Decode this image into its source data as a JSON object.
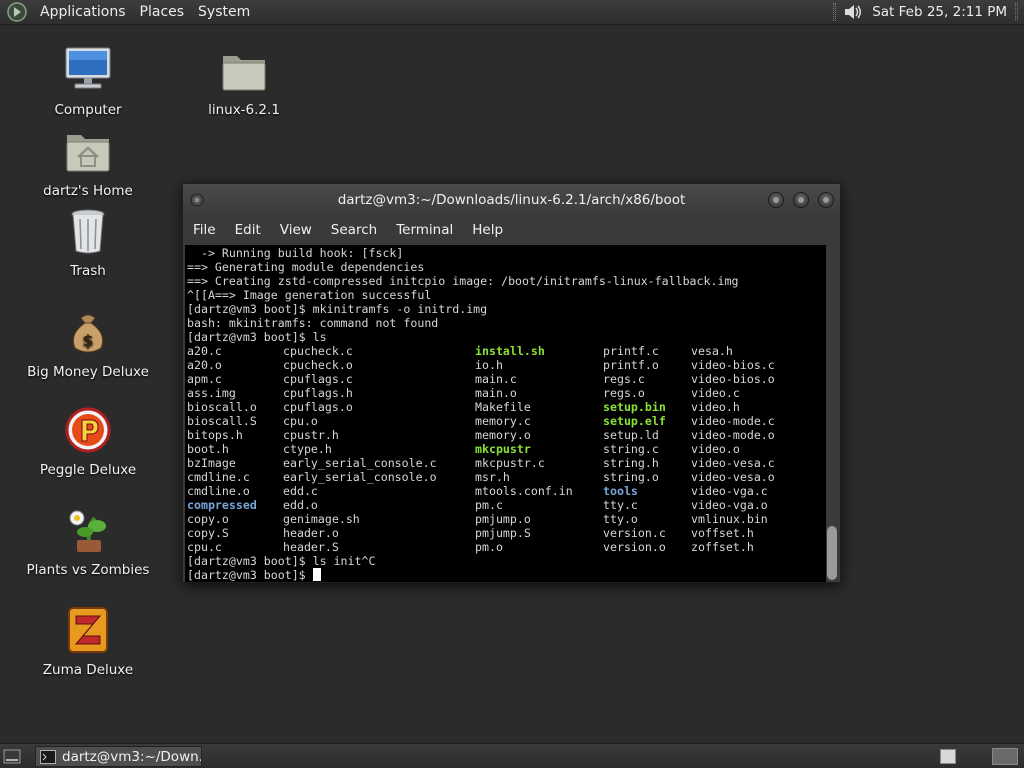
{
  "top_panel": {
    "menus": [
      "Applications",
      "Places",
      "System"
    ],
    "clock": "Sat Feb 25,  2:11 PM"
  },
  "desktop": {
    "icons": [
      {
        "label": "Computer",
        "icon": "computer-icon"
      },
      {
        "label": "linux-6.2.1",
        "icon": "folder-icon"
      },
      {
        "label": "dartz's Home",
        "icon": "home-folder-icon"
      },
      {
        "label": "Trash",
        "icon": "trash-icon"
      },
      {
        "label": "Big Money Deluxe",
        "icon": "money-bag-icon"
      },
      {
        "label": "Peggle Deluxe",
        "icon": "peggle-icon"
      },
      {
        "label": "Plants vs Zombies",
        "icon": "plants-vs-zombies-icon"
      },
      {
        "label": "Zuma Deluxe",
        "icon": "zuma-icon"
      }
    ]
  },
  "terminal": {
    "title": "dartz@vm3:~/Downloads/linux-6.2.1/arch/x86/boot",
    "menu": [
      "File",
      "Edit",
      "View",
      "Search",
      "Terminal",
      "Help"
    ],
    "lines_before": [
      "  -> Running build hook: [fsck]",
      "==> Generating module dependencies",
      "==> Creating zstd-compressed initcpio image: /boot/initramfs-linux-fallback.img",
      "^[[A==> Image generation successful",
      "[dartz@vm3 boot]$ mkinitramfs -o initrd.img",
      "bash: mkinitramfs: command not found",
      "[dartz@vm3 boot]$ ls"
    ],
    "ls_rows": [
      [
        {
          "t": "a20.c",
          "k": ""
        },
        {
          "t": "cpucheck.c",
          "k": ""
        },
        {
          "t": "install.sh",
          "k": "exe"
        },
        {
          "t": "printf.c",
          "k": ""
        },
        {
          "t": "vesa.h",
          "k": ""
        }
      ],
      [
        {
          "t": "a20.o",
          "k": ""
        },
        {
          "t": "cpucheck.o",
          "k": ""
        },
        {
          "t": "io.h",
          "k": ""
        },
        {
          "t": "printf.o",
          "k": ""
        },
        {
          "t": "video-bios.c",
          "k": ""
        }
      ],
      [
        {
          "t": "apm.c",
          "k": ""
        },
        {
          "t": "cpuflags.c",
          "k": ""
        },
        {
          "t": "main.c",
          "k": ""
        },
        {
          "t": "regs.c",
          "k": ""
        },
        {
          "t": "video-bios.o",
          "k": ""
        }
      ],
      [
        {
          "t": "ass.img",
          "k": ""
        },
        {
          "t": "cpuflags.h",
          "k": ""
        },
        {
          "t": "main.o",
          "k": ""
        },
        {
          "t": "regs.o",
          "k": ""
        },
        {
          "t": "video.c",
          "k": ""
        }
      ],
      [
        {
          "t": "bioscall.o",
          "k": ""
        },
        {
          "t": "cpuflags.o",
          "k": ""
        },
        {
          "t": "Makefile",
          "k": ""
        },
        {
          "t": "setup.bin",
          "k": "exe"
        },
        {
          "t": "video.h",
          "k": ""
        }
      ],
      [
        {
          "t": "bioscall.S",
          "k": ""
        },
        {
          "t": "cpu.o",
          "k": ""
        },
        {
          "t": "memory.c",
          "k": ""
        },
        {
          "t": "setup.elf",
          "k": "exe"
        },
        {
          "t": "video-mode.c",
          "k": ""
        }
      ],
      [
        {
          "t": "bitops.h",
          "k": ""
        },
        {
          "t": "cpustr.h",
          "k": ""
        },
        {
          "t": "memory.o",
          "k": ""
        },
        {
          "t": "setup.ld",
          "k": ""
        },
        {
          "t": "video-mode.o",
          "k": ""
        }
      ],
      [
        {
          "t": "boot.h",
          "k": ""
        },
        {
          "t": "ctype.h",
          "k": ""
        },
        {
          "t": "mkcpustr",
          "k": "exe"
        },
        {
          "t": "string.c",
          "k": ""
        },
        {
          "t": "video.o",
          "k": ""
        }
      ],
      [
        {
          "t": "bzImage",
          "k": ""
        },
        {
          "t": "early_serial_console.c",
          "k": ""
        },
        {
          "t": "mkcpustr.c",
          "k": ""
        },
        {
          "t": "string.h",
          "k": ""
        },
        {
          "t": "video-vesa.c",
          "k": ""
        }
      ],
      [
        {
          "t": "cmdline.c",
          "k": ""
        },
        {
          "t": "early_serial_console.o",
          "k": ""
        },
        {
          "t": "msr.h",
          "k": ""
        },
        {
          "t": "string.o",
          "k": ""
        },
        {
          "t": "video-vesa.o",
          "k": ""
        }
      ],
      [
        {
          "t": "cmdline.o",
          "k": ""
        },
        {
          "t": "edd.c",
          "k": ""
        },
        {
          "t": "mtools.conf.in",
          "k": ""
        },
        {
          "t": "tools",
          "k": "dir"
        },
        {
          "t": "video-vga.c",
          "k": ""
        }
      ],
      [
        {
          "t": "compressed",
          "k": "dir"
        },
        {
          "t": "edd.o",
          "k": ""
        },
        {
          "t": "pm.c",
          "k": ""
        },
        {
          "t": "tty.c",
          "k": ""
        },
        {
          "t": "video-vga.o",
          "k": ""
        }
      ],
      [
        {
          "t": "copy.o",
          "k": ""
        },
        {
          "t": "genimage.sh",
          "k": ""
        },
        {
          "t": "pmjump.o",
          "k": ""
        },
        {
          "t": "tty.o",
          "k": ""
        },
        {
          "t": "vmlinux.bin",
          "k": ""
        }
      ],
      [
        {
          "t": "copy.S",
          "k": ""
        },
        {
          "t": "header.o",
          "k": ""
        },
        {
          "t": "pmjump.S",
          "k": ""
        },
        {
          "t": "version.c",
          "k": ""
        },
        {
          "t": "voffset.h",
          "k": ""
        }
      ],
      [
        {
          "t": "cpu.c",
          "k": ""
        },
        {
          "t": "header.S",
          "k": ""
        },
        {
          "t": "pm.o",
          "k": ""
        },
        {
          "t": "version.o",
          "k": ""
        },
        {
          "t": "zoffset.h",
          "k": ""
        }
      ]
    ],
    "lines_after": [
      "[dartz@vm3 boot]$ ls init^C"
    ],
    "prompt": "[dartz@vm3 boot]$ "
  },
  "bottom_panel": {
    "task_label": "dartz@vm3:~/Down..."
  },
  "colors": {
    "executable": "#8ae234",
    "directory": "#7aa6da",
    "desktop_bg": "#2b2b2b"
  }
}
